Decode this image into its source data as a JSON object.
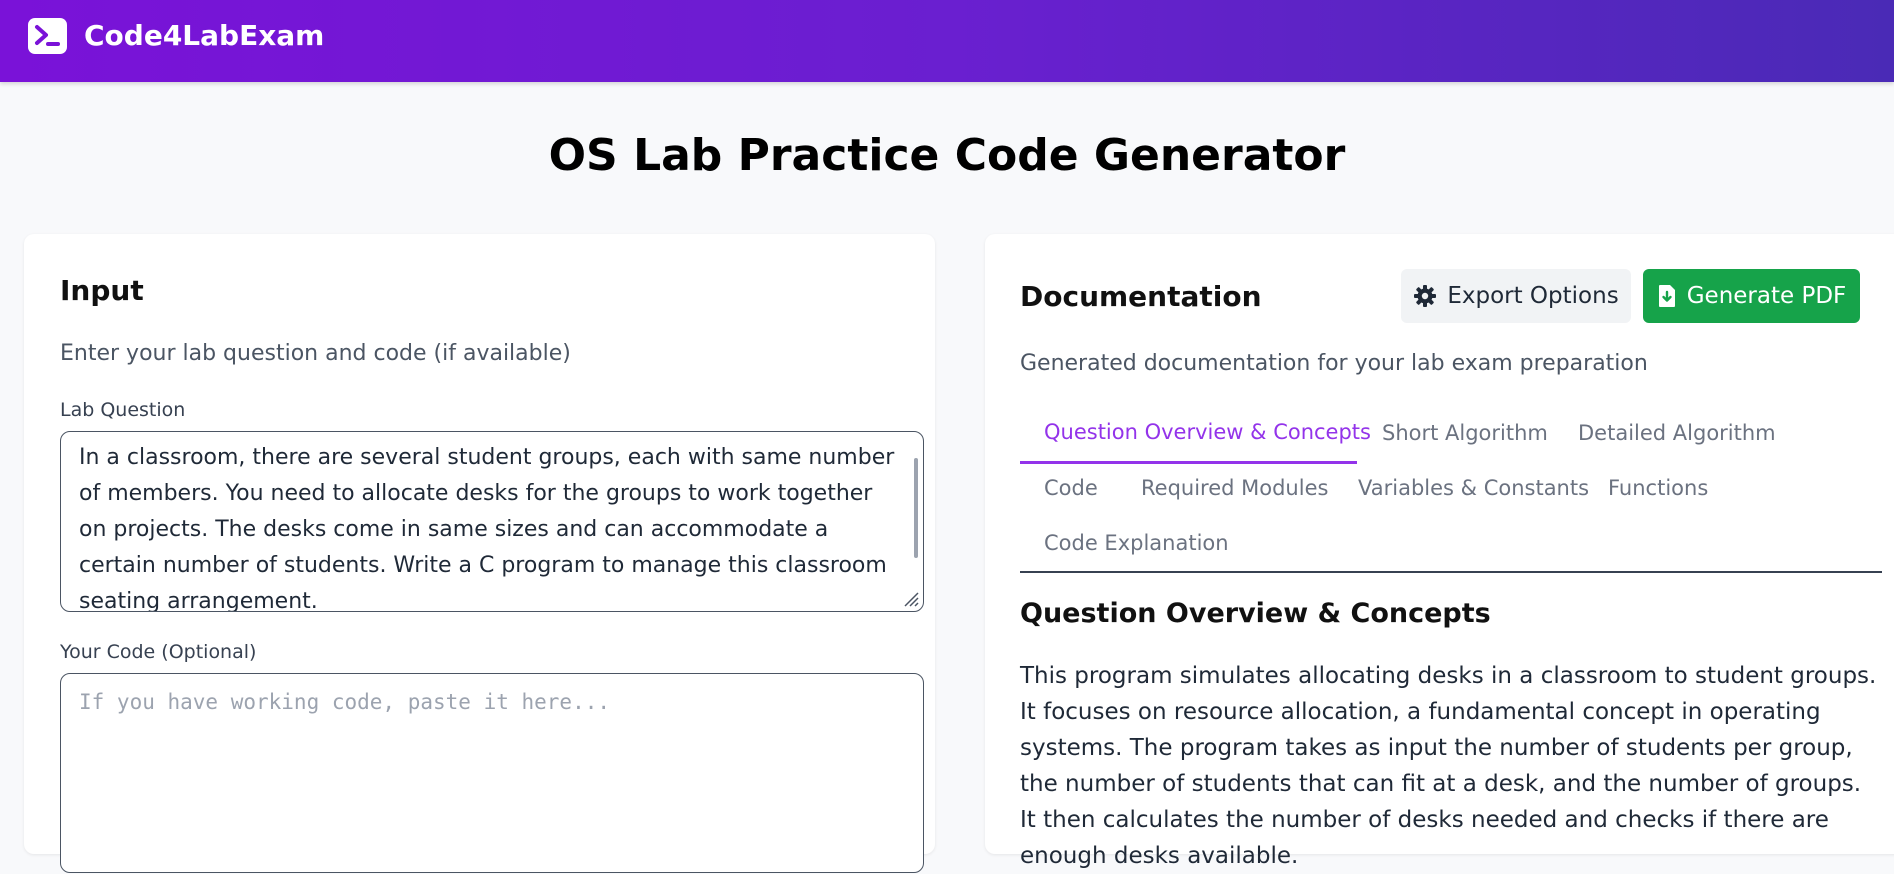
{
  "app": {
    "name": "Code4LabExam"
  },
  "page": {
    "title": "OS Lab Practice Code Generator"
  },
  "input_panel": {
    "title": "Input",
    "subtitle": "Enter your lab question and code (if available)",
    "question_label": "Lab Question",
    "question_value": "In a classroom, there are several student groups, each with same number of members. You need to allocate desks for the groups to work together on projects. The desks come in same sizes and can accommodate a certain number of students. Write a C program to manage this classroom seating arrangement.",
    "code_label": "Your Code (Optional)",
    "code_placeholder": "If you have working code, paste it here..."
  },
  "documentation_panel": {
    "title": "Documentation",
    "subtitle": "Generated documentation for your lab exam preparation",
    "export_button": "Export Options",
    "pdf_button": "Generate PDF",
    "tabs": [
      "Question Overview & Concepts",
      "Short Algorithm",
      "Detailed Algorithm",
      "Code",
      "Required Modules",
      "Variables & Constants",
      "Functions",
      "Code Explanation"
    ],
    "active_tab": "Question Overview & Concepts",
    "section_title": "Question Overview & Concepts",
    "section_text": "This program simulates allocating desks in a classroom to student groups.  It focuses on resource allocation, a fundamental concept in operating systems. The program takes as input the number of students per group, the number of students that can fit at a desk, and the number of groups. It then calculates the number of desks needed and checks if there are enough desks available."
  },
  "colors": {
    "header_gradient_start": "#7a12d8",
    "header_gradient_end": "#4a2ab6",
    "accent": "#9333ea",
    "pdf_button": "#16a34a"
  },
  "icons": [
    "terminal-icon",
    "gear-icon",
    "file-download-icon",
    "resize-handle-icon"
  ]
}
